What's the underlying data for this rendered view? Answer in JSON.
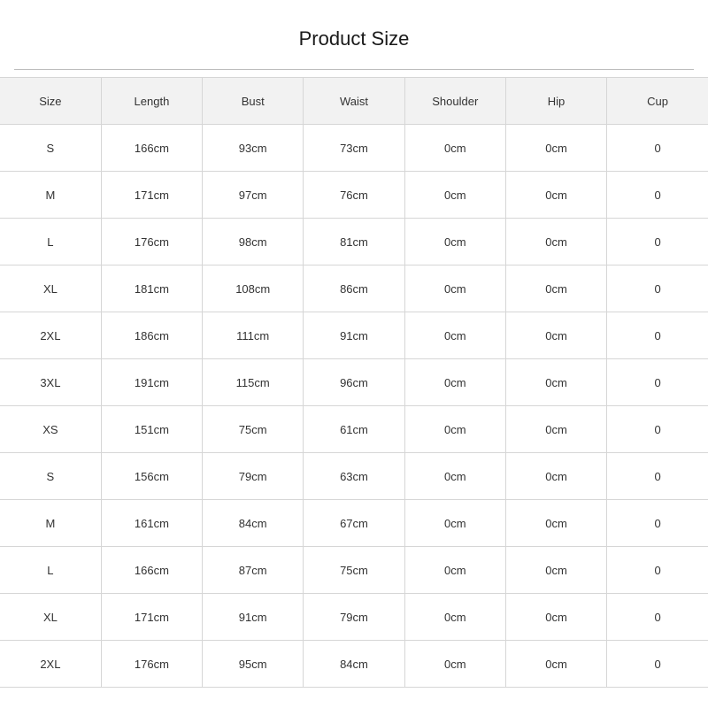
{
  "page": {
    "title": "Product Size"
  },
  "table": {
    "headers": [
      "Size",
      "Length",
      "Bust",
      "Waist",
      "Shoulder",
      "Hip",
      "Cup"
    ],
    "rows": [
      [
        "S",
        "166cm",
        "93cm",
        "73cm",
        "0cm",
        "0cm",
        "0"
      ],
      [
        "M",
        "171cm",
        "97cm",
        "76cm",
        "0cm",
        "0cm",
        "0"
      ],
      [
        "L",
        "176cm",
        "98cm",
        "81cm",
        "0cm",
        "0cm",
        "0"
      ],
      [
        "XL",
        "181cm",
        "108cm",
        "86cm",
        "0cm",
        "0cm",
        "0"
      ],
      [
        "2XL",
        "186cm",
        "111cm",
        "91cm",
        "0cm",
        "0cm",
        "0"
      ],
      [
        "3XL",
        "191cm",
        "115cm",
        "96cm",
        "0cm",
        "0cm",
        "0"
      ],
      [
        "XS",
        "151cm",
        "75cm",
        "61cm",
        "0cm",
        "0cm",
        "0"
      ],
      [
        "S",
        "156cm",
        "79cm",
        "63cm",
        "0cm",
        "0cm",
        "0"
      ],
      [
        "M",
        "161cm",
        "84cm",
        "67cm",
        "0cm",
        "0cm",
        "0"
      ],
      [
        "L",
        "166cm",
        "87cm",
        "75cm",
        "0cm",
        "0cm",
        "0"
      ],
      [
        "XL",
        "171cm",
        "91cm",
        "79cm",
        "0cm",
        "0cm",
        "0"
      ],
      [
        "2XL",
        "176cm",
        "95cm",
        "84cm",
        "0cm",
        "0cm",
        "0"
      ]
    ]
  },
  "colors": {
    "header_background": "#f2f2f2",
    "grid_line": "#d6d6d6",
    "text": "#333333"
  }
}
